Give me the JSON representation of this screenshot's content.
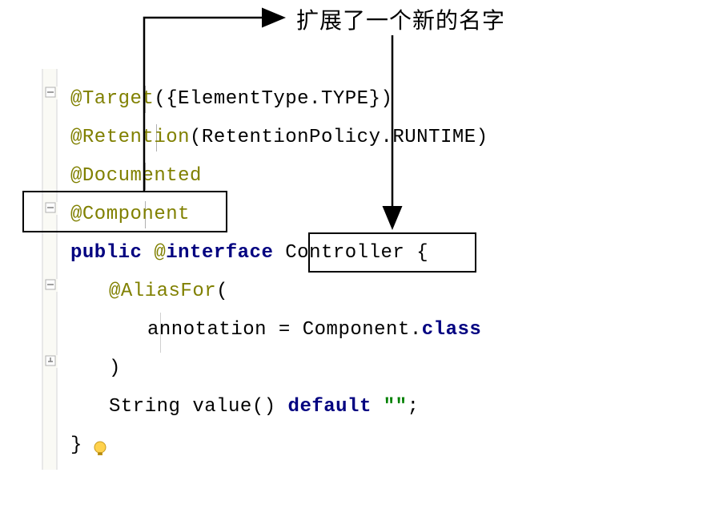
{
  "annotation": {
    "label": "扩展了一个新的名字"
  },
  "code": {
    "line1_at": "@Target",
    "line1_rest": "({ElementType.TYPE})",
    "line2_at": "@Retention",
    "line2_rest": "(RetentionPolicy.RUNTIME)",
    "line3_at": "@Documented",
    "line4_at": "@Component",
    "line5_public": "public ",
    "line5_at": "@",
    "line5_interface": "interface",
    "line5_name": " Controller ",
    "line5_brace": "{",
    "line6_at": "@AliasFor",
    "line6_paren": "(",
    "line7_text": "annotation = Component.",
    "line7_class": "class",
    "line8_paren": ")",
    "line9_a": "String value() ",
    "line9_default": "default",
    "line9_sp": " ",
    "line9_str": "\"\"",
    "line9_semi": ";",
    "line10_brace": "}"
  },
  "boxes": {
    "component": "component-highlight",
    "controller": "controller-highlight"
  }
}
